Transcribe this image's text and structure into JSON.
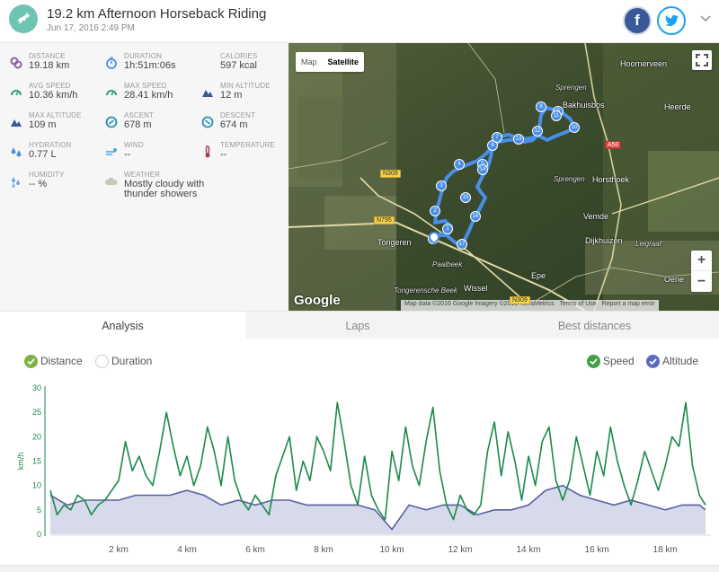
{
  "header": {
    "title": "19.2 km Afternoon Horseback Riding",
    "date": "Jun 17, 2016 2:49 PM",
    "share": {
      "facebook_label": "f"
    }
  },
  "stats": [
    {
      "label": "DISTANCE",
      "value": "19.18 km",
      "icon": "distance-icon",
      "color": "#8e5fa5"
    },
    {
      "label": "DURATION",
      "value": "1h:51m:06s",
      "icon": "stopwatch-icon",
      "color": "#4a90e2"
    },
    {
      "label": "CALORIES",
      "value": "597 kcal",
      "icon": "flame-icon",
      "color": "#e8613c"
    },
    {
      "label": "AVG SPEED",
      "value": "10.36 km/h",
      "icon": "speedometer-icon",
      "color": "#2e9e7a"
    },
    {
      "label": "MAX SPEED",
      "value": "28.41 km/h",
      "icon": "speedometer-icon",
      "color": "#2e9e7a"
    },
    {
      "label": "MIN ALTITUDE",
      "value": "12 m",
      "icon": "mountain-icon",
      "color": "#3a5a9a"
    },
    {
      "label": "MAX ALTITUDE",
      "value": "109 m",
      "icon": "mountain-icon",
      "color": "#3a5a9a"
    },
    {
      "label": "ASCENT",
      "value": "678 m",
      "icon": "ascent-icon",
      "color": "#2b8fb0"
    },
    {
      "label": "DESCENT",
      "value": "674 m",
      "icon": "descent-icon",
      "color": "#2b8fb0"
    },
    {
      "label": "HYDRATION",
      "value": "0.77 L",
      "icon": "droplets-icon",
      "color": "#4a90e2"
    },
    {
      "label": "WIND",
      "value": "--",
      "icon": "wind-icon",
      "color": "#4aa3df"
    },
    {
      "label": "TEMPERATURE",
      "value": "--",
      "icon": "thermometer-icon",
      "color": "#a0404a"
    },
    {
      "label": "HUMIDITY",
      "value": "-- %",
      "icon": "humidity-icon",
      "color": "#6da5e0"
    },
    {
      "label": "WEATHER",
      "value": "Mostly cloudy with thunder showers",
      "icon": "cloud-icon",
      "color": "#c9c9b6"
    }
  ],
  "map": {
    "type_buttons": [
      "Map",
      "Satellite"
    ],
    "selected_type": "Satellite",
    "zoom_in": "+",
    "zoom_out": "−",
    "attribution": [
      "Map data ©2016 Google Imagery ©2016 TerraMetrics",
      "Terms of Use",
      "Report a map error"
    ],
    "logo": "Google",
    "places": [
      "Hoornerveen",
      "Sprengen",
      "Bakhuisbos",
      "Heerde",
      "A50",
      "N309",
      "Sprengen",
      "Horsthoek",
      "Vemde",
      "N795",
      "Tongeren",
      "Dijkhuizen",
      "Leigraaf",
      "Paalbeek",
      "Epe",
      "Oene",
      "Wissel",
      "Tongerensche Beek",
      "N309"
    ],
    "markers": [
      "1",
      "2",
      "3",
      "4",
      "5",
      "6",
      "7",
      "8",
      "9",
      "10",
      "11",
      "12",
      "13",
      "14",
      "15",
      "16",
      "17",
      "18"
    ],
    "route_color": "#4a8fe7"
  },
  "tabs": [
    {
      "label": "Analysis",
      "active": true
    },
    {
      "label": "Laps",
      "active": false
    },
    {
      "label": "Best distances",
      "active": false
    }
  ],
  "legend": {
    "distance": "Distance",
    "duration": "Duration",
    "speed": "Speed",
    "altitude": "Altitude"
  },
  "chart_data": {
    "type": "line",
    "x_axis": "distance",
    "xlabel": "",
    "ylabel": "km/h",
    "ylim": [
      0,
      30
    ],
    "y_ticks": [
      0,
      5,
      10,
      15,
      20,
      25,
      30
    ],
    "xlim": [
      0,
      19.18
    ],
    "x_ticks": [
      2,
      4,
      6,
      8,
      10,
      12,
      14,
      16,
      18
    ],
    "x_tick_suffix": " km",
    "grid": false,
    "series": [
      {
        "name": "Speed",
        "color": "#1b8a4a",
        "x": [
          0.0,
          0.2,
          0.4,
          0.6,
          0.8,
          1.0,
          1.2,
          1.4,
          1.6,
          1.8,
          2.0,
          2.2,
          2.4,
          2.6,
          2.8,
          3.0,
          3.2,
          3.4,
          3.6,
          3.8,
          4.0,
          4.2,
          4.4,
          4.6,
          4.8,
          5.0,
          5.2,
          5.4,
          5.6,
          5.8,
          6.0,
          6.2,
          6.4,
          6.6,
          6.8,
          7.0,
          7.2,
          7.4,
          7.6,
          7.8,
          8.0,
          8.2,
          8.4,
          8.6,
          8.8,
          9.0,
          9.2,
          9.4,
          9.6,
          9.8,
          10.0,
          10.2,
          10.4,
          10.6,
          10.8,
          11.0,
          11.2,
          11.4,
          11.6,
          11.8,
          12.0,
          12.2,
          12.4,
          12.6,
          12.8,
          13.0,
          13.2,
          13.4,
          13.6,
          13.8,
          14.0,
          14.2,
          14.4,
          14.6,
          14.8,
          15.0,
          15.2,
          15.4,
          15.6,
          15.8,
          16.0,
          16.2,
          16.4,
          16.6,
          16.8,
          17.0,
          17.2,
          17.4,
          17.6,
          17.8,
          18.0,
          18.2,
          18.4,
          18.6,
          18.8,
          19.0,
          19.18
        ],
        "values": [
          9,
          4,
          6,
          5,
          8,
          7,
          4,
          6,
          7,
          9,
          11,
          19,
          13,
          16,
          12,
          10,
          17,
          25,
          18,
          12,
          16,
          10,
          14,
          22,
          17,
          10,
          20,
          11,
          7,
          5,
          8,
          6,
          4,
          12,
          16,
          20,
          9,
          15,
          11,
          20,
          17,
          13,
          27,
          19,
          10,
          6,
          16,
          8,
          5,
          3,
          17,
          11,
          22,
          14,
          10,
          19,
          26,
          13,
          6,
          3,
          8,
          5,
          4,
          6,
          17,
          23,
          12,
          21,
          15,
          7,
          16,
          10,
          19,
          22,
          11,
          7,
          11,
          20,
          14,
          8,
          17,
          12,
          22,
          15,
          10,
          6,
          11,
          17,
          13,
          9,
          14,
          20,
          18,
          27,
          14,
          8,
          6
        ],
        "data_labels": false
      },
      {
        "name": "Altitude",
        "color": "#5a5fa5",
        "fill": "#d6daea",
        "x": [
          0.0,
          0.5,
          1.0,
          1.5,
          2.0,
          2.5,
          3.0,
          3.5,
          4.0,
          4.5,
          5.0,
          5.5,
          6.0,
          6.5,
          7.0,
          7.5,
          8.0,
          8.5,
          9.0,
          9.5,
          10.0,
          10.5,
          11.0,
          11.5,
          12.0,
          12.5,
          13.0,
          13.5,
          14.0,
          14.5,
          15.0,
          15.5,
          16.0,
          16.5,
          17.0,
          17.5,
          18.0,
          18.5,
          19.0,
          19.18
        ],
        "values": [
          8,
          6,
          7,
          7,
          7,
          8,
          8,
          8,
          9,
          8,
          6,
          7,
          6,
          7,
          7,
          6,
          6,
          6,
          6,
          5,
          1,
          6,
          5,
          6,
          6,
          4,
          5,
          5,
          6,
          9,
          10,
          8,
          7,
          6,
          7,
          6,
          5,
          6,
          6,
          5
        ]
      }
    ]
  }
}
